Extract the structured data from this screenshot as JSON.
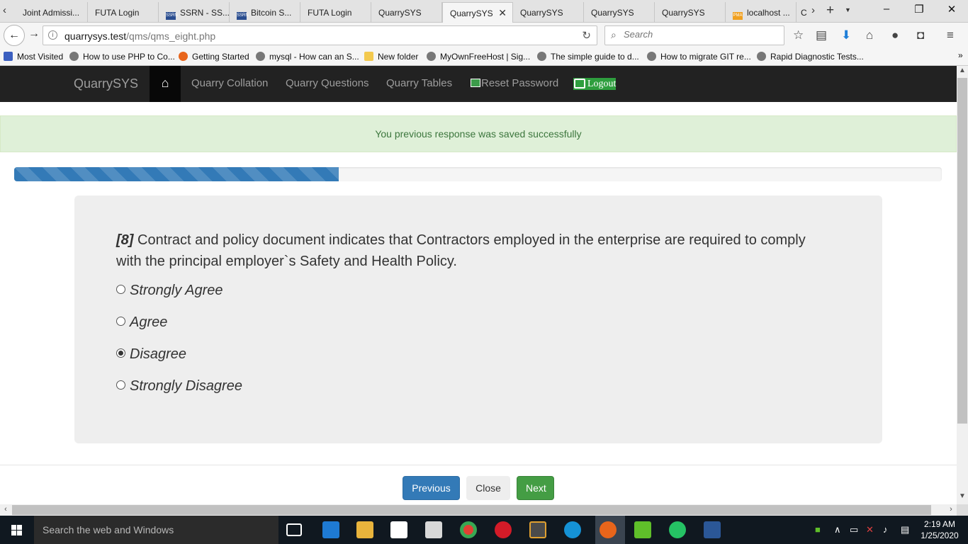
{
  "browser": {
    "tabs": [
      {
        "label": "Joint Admissi...",
        "favicon": "globe-icon"
      },
      {
        "label": "FUTA Login",
        "favicon": "none"
      },
      {
        "label": "SSRN - SS...",
        "favicon": "ssrn-icon"
      },
      {
        "label": "Bitcoin S...",
        "favicon": "ssrn-icon"
      },
      {
        "label": "FUTA Login",
        "favicon": "none"
      },
      {
        "label": "QuarrySYS",
        "favicon": "none"
      },
      {
        "label": "QuarrySYS",
        "favicon": "none",
        "active": true
      },
      {
        "label": "QuarrySYS",
        "favicon": "none"
      },
      {
        "label": "QuarrySYS",
        "favicon": "none"
      },
      {
        "label": "QuarrySYS",
        "favicon": "none"
      },
      {
        "label": "localhost ...",
        "favicon": "phpmyadmin-icon"
      },
      {
        "label": "C",
        "favicon": "none"
      }
    ],
    "url_host": "quarrysys.test",
    "url_path": "/qms/qms_eight.php",
    "search_placeholder": "Search",
    "bookmarks": [
      {
        "label": "Most Visited",
        "icon": "bookmark-icon"
      },
      {
        "label": "How to use PHP to Co...",
        "icon": "globe-icon"
      },
      {
        "label": "Getting Started",
        "icon": "firefox-icon"
      },
      {
        "label": "mysql - How can an S...",
        "icon": "globe-icon"
      },
      {
        "label": "New folder",
        "icon": "folder-icon"
      },
      {
        "label": "MyOwnFreeHost | Sig...",
        "icon": "globe-icon"
      },
      {
        "label": "The simple guide to d...",
        "icon": "globe-icon"
      },
      {
        "label": "How to migrate GIT re...",
        "icon": "globe-icon"
      },
      {
        "label": "Rapid Diagnostic Tests...",
        "icon": "globe-icon"
      }
    ]
  },
  "app": {
    "brand": "QuarrySYS",
    "nav": {
      "collation": "Quarry Collation",
      "questions": "Quarry Questions",
      "tables": "Quarry Tables",
      "reset": "Reset Password",
      "logout": "Logout"
    },
    "alert": "You previous response was saved successfully",
    "progress_fraction": 0.35,
    "question": {
      "number": "[8]",
      "text": "Contract and policy document indicates that Contractors employed in the enterprise are required to comply with the principal employer`s Safety and Health Policy."
    },
    "options": [
      "Strongly Agree",
      "Agree",
      "Disagree",
      "Strongly Disagree"
    ],
    "selected_option": "Disagree",
    "buttons": {
      "previous": "Previous",
      "close": "Close",
      "next": "Next"
    }
  },
  "taskbar": {
    "search_placeholder": "Search the web and Windows",
    "time": "2:19 AM",
    "date": "1/25/2020"
  },
  "colors": {
    "navbar": "#222222",
    "primary": "#337ab7",
    "success": "#449d44",
    "alert_bg": "#dff0d8",
    "alert_text": "#3c763d"
  }
}
